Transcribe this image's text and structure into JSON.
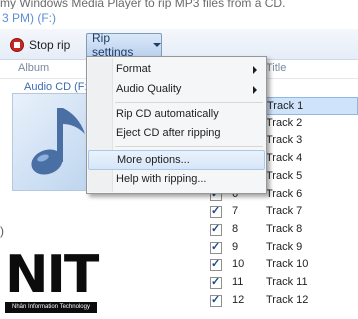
{
  "caption": {
    "text": "my Windows Media Player to rip MP3 files from a CD."
  },
  "window": {
    "title": "3 PM) (F:)"
  },
  "toolbar": {
    "stop_rip_label": "Stop rip",
    "rip_settings_label": "Rip settings"
  },
  "list": {
    "col_album": "Album",
    "col_title": "Title",
    "album_name": "Audio CD (F:)",
    "left_bracket": ")"
  },
  "menu": {
    "items": [
      {
        "label": "Format",
        "submenu": true
      },
      {
        "label": "Audio Quality",
        "submenu": true
      },
      {
        "label": "Rip CD automatically"
      },
      {
        "label": "Eject CD after ripping"
      },
      {
        "label": "More options...",
        "highlighted": true
      },
      {
        "label": "Help with ripping..."
      }
    ]
  },
  "tracks": [
    {
      "num": "",
      "name": "Track 1",
      "selected": true
    },
    {
      "num": "",
      "name": "Track 2"
    },
    {
      "num": "",
      "name": "Track 3"
    },
    {
      "num": "",
      "name": "Track 4"
    },
    {
      "num": "",
      "name": "Track 5"
    },
    {
      "num": "6",
      "name": "Track 6",
      "checked": true
    },
    {
      "num": "7",
      "name": "Track 7",
      "checked": true
    },
    {
      "num": "8",
      "name": "Track 8",
      "checked": true
    },
    {
      "num": "9",
      "name": "Track 9",
      "checked": true
    },
    {
      "num": "10",
      "name": "Track 10",
      "checked": true
    },
    {
      "num": "11",
      "name": "Track 11",
      "checked": true
    },
    {
      "num": "12",
      "name": "Track 12",
      "checked": true
    }
  ],
  "logo": {
    "letters": "NIT",
    "subtitle": "Nhân Information Technology"
  },
  "colors": {
    "accent": "#5b8fd0",
    "stop": "#c8261e",
    "selection": "#cfe3fb"
  }
}
